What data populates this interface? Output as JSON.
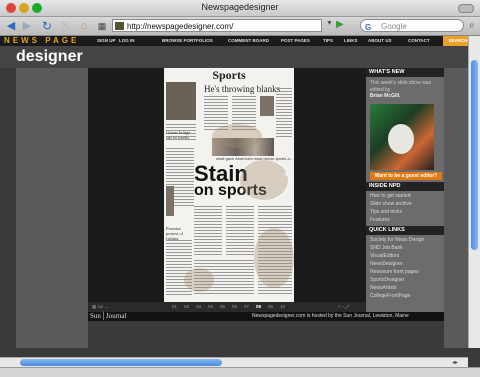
{
  "window": {
    "title": "Newspagedesigner"
  },
  "toolbar": {
    "url": "http://newspagedesigner.com/",
    "search_placeholder": "Google",
    "search_engine": "G",
    "icons": [
      "back-icon",
      "forward-icon",
      "refresh-icon",
      "stop-icon",
      "home-icon",
      "favicon"
    ]
  },
  "nav": {
    "brand": "NEWS PAGE",
    "items": [
      "SIGN UP",
      "LOG IN",
      "BROWSE PORTFOLIOS",
      "COMMENT BOARD",
      "POST PAGES",
      "TIPS",
      "LINKS",
      "ABOUT US",
      "CONTACT"
    ],
    "search": "SEARCH"
  },
  "brand2": "designer",
  "page": {
    "section": "Sports",
    "headline": "He's throwing blanks",
    "caption": "Stain on sports",
    "stain_word": "Stain",
    "stain_line2": "on sports",
    "faces_caption": "what gave America's most heroic sports a...",
    "col_title": "Giants bridge sits in weeks",
    "promise": "Promise protest of fishing",
    "footer_col": "Sports"
  },
  "pager": {
    "pages": [
      "01",
      "02",
      "03",
      "04",
      "05",
      "06",
      "07",
      "08",
      "09",
      "10"
    ],
    "active": "08",
    "left_controls": "▦  1ø  →",
    "right_controls": "+  −  ⤢"
  },
  "footer": {
    "logo": "Sun│Journal",
    "hosted": "Newspagedesigner.com is hosted by the Sun Journal, Lewiston, Maine"
  },
  "sidebar": {
    "whats_new": {
      "heading": "WHAT'S NEW",
      "text": "This week's slide show was edited by",
      "name": "Brian McGill."
    },
    "guest_editor": "Want to be a guest editor?",
    "inside": {
      "heading": "INSIDE NPD",
      "links": [
        "How to get started",
        "Slide show archive",
        "Tips and tricks",
        "Features"
      ]
    },
    "quick": {
      "heading": "QUICK LINKS",
      "links": [
        "Society for News Design",
        "SND Job Bank",
        "VisualEditors",
        "NewsDesigner",
        "Newseum front pages",
        "SportsDesigner",
        "NewsArtists",
        "CollegeFrontPage"
      ]
    }
  },
  "colors": {
    "accent": "#e8a22a",
    "guest": "#e07a12",
    "scroll": "#4a8de0"
  }
}
